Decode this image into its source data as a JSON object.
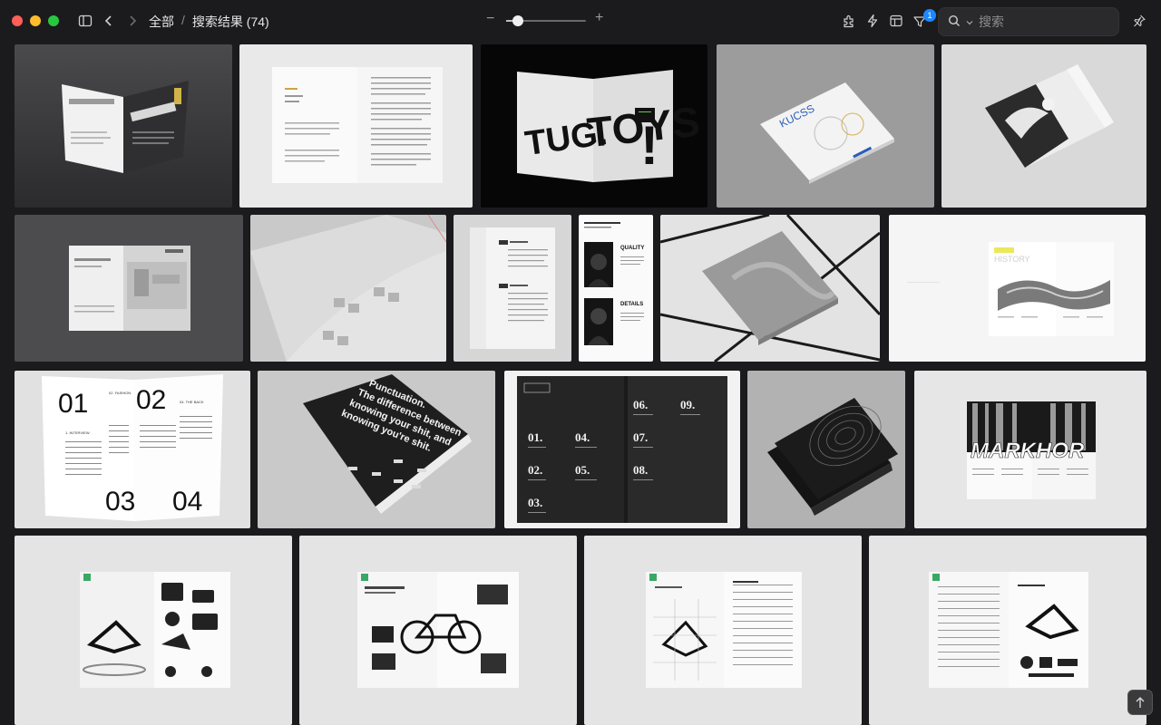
{
  "breadcrumb": {
    "root": "全部",
    "separator": "/",
    "current": "搜索结果 (74)"
  },
  "zoom": {
    "minus": "−",
    "plus": "+",
    "level": 0.15
  },
  "filter_badge": "1",
  "search": {
    "placeholder": "搜索"
  },
  "tiles": [
    {
      "name": "tile-4m1-series-locking"
    },
    {
      "name": "tile-text-spread"
    },
    {
      "name": "tile-tug-toys",
      "texts": [
        "TUG.",
        "TOYS",
        "!"
      ]
    },
    {
      "name": "tile-kucss-book",
      "texts": [
        "KUCSS"
      ]
    },
    {
      "name": "tile-wing-magazine"
    },
    {
      "name": "tile-factory-brochure"
    },
    {
      "name": "tile-grey-open-book"
    },
    {
      "name": "tile-contents-page"
    },
    {
      "name": "tile-quality-details",
      "texts": [
        "QUALITY",
        "DETAILS"
      ]
    },
    {
      "name": "tile-grey-hardcover"
    },
    {
      "name": "tile-history-spread",
      "texts": [
        "HISTORY"
      ]
    },
    {
      "name": "tile-interview-spread",
      "texts": [
        "01",
        "02",
        "03",
        "04",
        "1. INTERVIEW",
        "02. FASHION",
        "04. THE BACK"
      ]
    },
    {
      "name": "tile-punctuation-book",
      "texts": [
        "Punctuation.",
        "The difference between",
        "knowing your shit, and",
        "knowing you're shit."
      ]
    },
    {
      "name": "tile-numbered-dark-spread",
      "texts": [
        "01.",
        "02.",
        "03.",
        "04.",
        "05.",
        "06.",
        "07.",
        "08.",
        "09."
      ]
    },
    {
      "name": "tile-dark-rings-book"
    },
    {
      "name": "tile-markhor-magazine",
      "texts": [
        "MARKHOR"
      ]
    },
    {
      "name": "tile-bike-frame-spread-1"
    },
    {
      "name": "tile-bike-full-spread"
    },
    {
      "name": "tile-bike-sketch-spread"
    },
    {
      "name": "tile-bike-parts-spread"
    }
  ]
}
